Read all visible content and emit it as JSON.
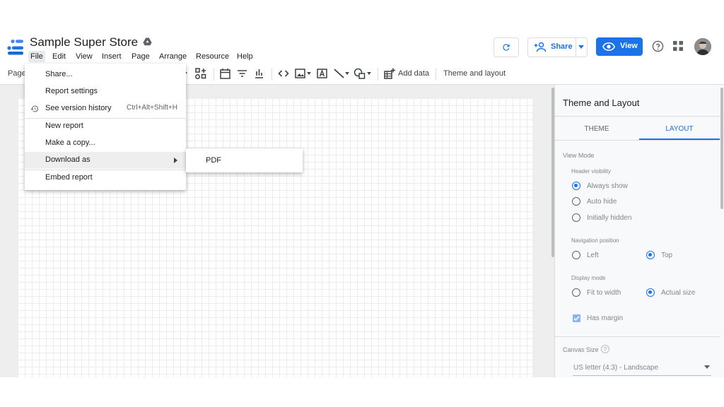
{
  "header": {
    "title": "Sample Super Store",
    "share_label": "Share",
    "view_label": "View"
  },
  "menubar": [
    "File",
    "Edit",
    "View",
    "Insert",
    "Page",
    "Arrange",
    "Resource",
    "Help"
  ],
  "toolbar": {
    "page_label": "Page",
    "add_data_label": "Add data",
    "theme_layout_label": "Theme and layout"
  },
  "file_menu": {
    "items": [
      {
        "label": "Share..."
      },
      {
        "label": "Report settings"
      },
      {
        "label": "See version history",
        "shortcut": "Ctrl+Alt+Shift+H"
      },
      {
        "label": "New report"
      },
      {
        "label": "Make a copy..."
      },
      {
        "label": "Download as"
      },
      {
        "label": "Embed report"
      }
    ],
    "submenu": {
      "label": "PDF"
    }
  },
  "panel": {
    "title": "Theme and Layout",
    "tabs": [
      "THEME",
      "LAYOUT"
    ],
    "active_tab": "LAYOUT",
    "view_mode_label": "View Mode",
    "header_visibility": {
      "label": "Header visibility",
      "options": [
        "Always show",
        "Auto hide",
        "Initially hidden"
      ],
      "selected": "Always show"
    },
    "navigation_position": {
      "label": "Navigation position",
      "options": [
        "Left",
        "Top"
      ],
      "selected": "Top"
    },
    "display_mode": {
      "label": "Display mode",
      "options": [
        "Fit to width",
        "Actual size"
      ],
      "selected": "Actual size"
    },
    "has_margin": {
      "label": "Has margin",
      "checked": true
    },
    "canvas_size": {
      "label": "Canvas Size",
      "help": "?",
      "value": "US letter (4:3) - Landscape"
    }
  },
  "colors": {
    "accent": "#1a73e8",
    "menu_highlight": "#eeeeee"
  }
}
